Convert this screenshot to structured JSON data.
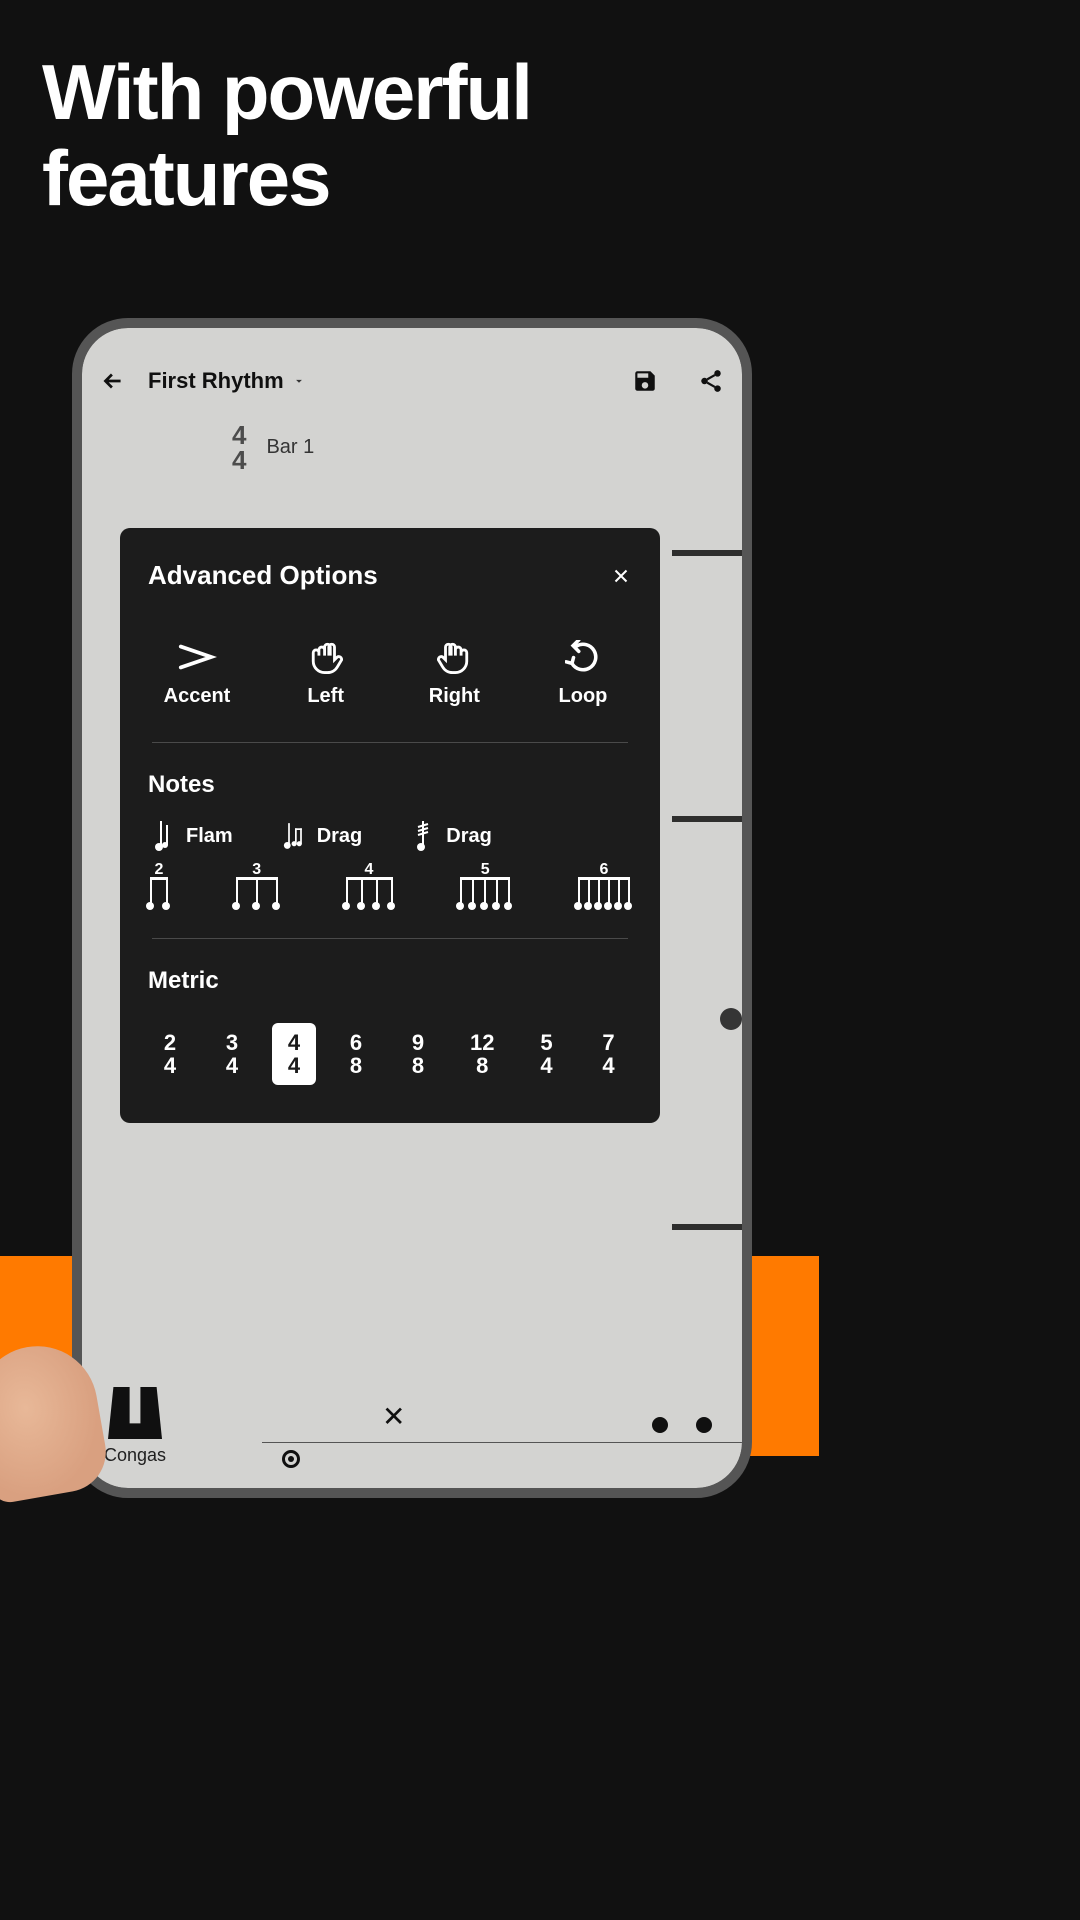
{
  "hero": {
    "line1": "With powerful",
    "line2": "features"
  },
  "topbar": {
    "title": "First Rhythm",
    "save_icon": "save-icon",
    "share_icon": "share-icon"
  },
  "time_signature": {
    "top": "4",
    "bottom": "4",
    "bar_label": "Bar 1"
  },
  "instrument": {
    "label": "Congas"
  },
  "modal": {
    "title": "Advanced Options",
    "actions": [
      {
        "label": "Accent",
        "icon": "accent"
      },
      {
        "label": "Left",
        "icon": "hand-left"
      },
      {
        "label": "Right",
        "icon": "hand-right"
      },
      {
        "label": "Loop",
        "icon": "loop"
      }
    ],
    "notes_title": "Notes",
    "notes": [
      {
        "label": "Flam"
      },
      {
        "label": "Drag"
      },
      {
        "label": "Drag"
      }
    ],
    "tuplets": [
      "2",
      "3",
      "4",
      "5",
      "6"
    ],
    "metric_title": "Metric",
    "metrics": [
      {
        "top": "2",
        "bottom": "4",
        "selected": false
      },
      {
        "top": "3",
        "bottom": "4",
        "selected": false
      },
      {
        "top": "4",
        "bottom": "4",
        "selected": true
      },
      {
        "top": "6",
        "bottom": "8",
        "selected": false
      },
      {
        "top": "9",
        "bottom": "8",
        "selected": false
      },
      {
        "top": "12",
        "bottom": "8",
        "selected": false
      },
      {
        "top": "5",
        "bottom": "4",
        "selected": false
      },
      {
        "top": "7",
        "bottom": "4",
        "selected": false
      }
    ]
  }
}
